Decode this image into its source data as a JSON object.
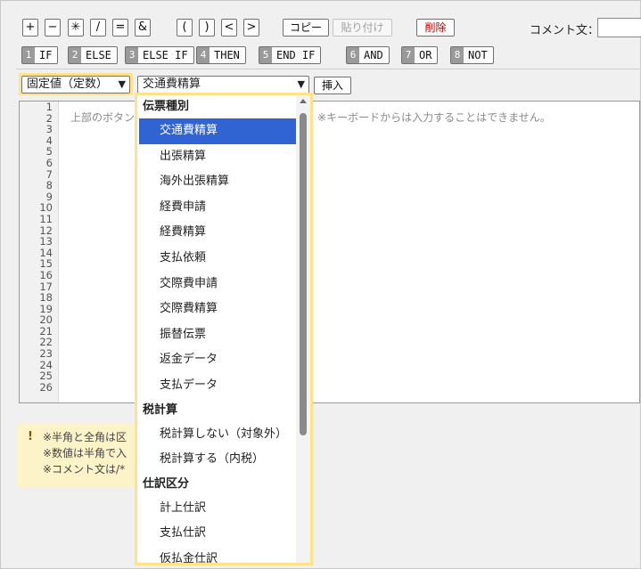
{
  "toolbar": {
    "operators": [
      "+",
      "−",
      "✳",
      "/",
      "=",
      "&",
      "(",
      ")",
      "<",
      ">"
    ],
    "copy_label": "コピー",
    "paste_label": "貼り付け",
    "delete_label": "削除",
    "comment_label": "コメント文：",
    "comment_value": ""
  },
  "keywords": [
    {
      "num": "1",
      "label": "IF"
    },
    {
      "num": "2",
      "label": "ELSE"
    },
    {
      "num": "3",
      "label": "ELSE IF"
    },
    {
      "num": "4",
      "label": "THEN"
    },
    {
      "num": "5",
      "label": "END IF"
    },
    {
      "num": "6",
      "label": "AND"
    },
    {
      "num": "7",
      "label": "OR"
    },
    {
      "num": "8",
      "label": "NOT"
    }
  ],
  "insert_row": {
    "type_select": "固定値（定数）",
    "value_select": "交通費精算",
    "insert_label": "挿入"
  },
  "editor": {
    "line_numbers": [
      "1",
      "2",
      "3",
      "4",
      "5",
      "6",
      "7",
      "8",
      "9",
      "10",
      "11",
      "12",
      "13",
      "14",
      "15",
      "16",
      "17",
      "18",
      "19",
      "20",
      "21",
      "22",
      "23",
      "24",
      "25",
      "26"
    ],
    "hint_left": "上部のボタン",
    "hint_right": "。※キーボードからは入力することはできません。"
  },
  "notice": {
    "line1": "※半角と全角は区",
    "line2": "※数値は半角で入",
    "line3": "※コメント文は/*"
  },
  "dropdown": {
    "groups": [
      {
        "label": "伝票種別",
        "options": [
          "交通費精算",
          "出張精算",
          "海外出張精算",
          "経費申請",
          "経費精算",
          "支払依頼",
          "交際費申請",
          "交際費精算",
          "振替伝票",
          "返金データ",
          "支払データ"
        ]
      },
      {
        "label": "税計算",
        "options": [
          "税計算しない（対象外）",
          "税計算する（内税）"
        ]
      },
      {
        "label": "仕訳区分",
        "options": [
          "計上仕訳",
          "支払仕訳",
          "仮払金仕訳"
        ]
      }
    ],
    "selected": "交通費精算"
  },
  "colors": {
    "highlight": "#ffe38a",
    "selection": "#3064d2",
    "danger": "#c00000"
  }
}
